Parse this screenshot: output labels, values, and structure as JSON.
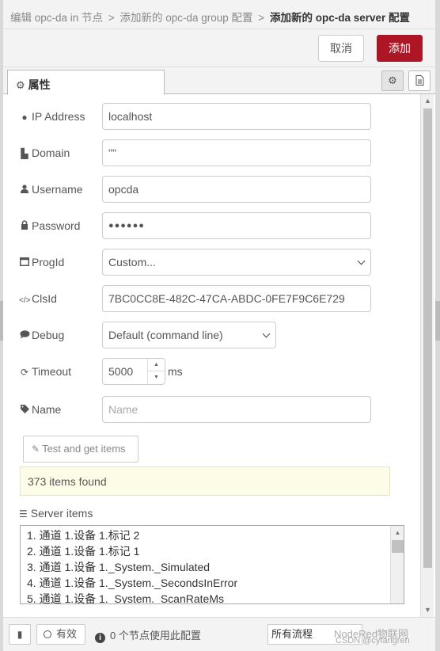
{
  "breadcrumb": {
    "items": [
      "编辑 opc-da in 节点",
      "添加新的 opc-da group 配置"
    ],
    "separator": ">",
    "current": "添加新的 opc-da server 配置"
  },
  "actions": {
    "cancel": "取消",
    "add": "添加"
  },
  "tabs": {
    "properties": "属性"
  },
  "form": {
    "ip_address": {
      "label": "IP Address",
      "value": "localhost"
    },
    "domain": {
      "label": "Domain",
      "value": "\"\""
    },
    "username": {
      "label": "Username",
      "value": "opcda"
    },
    "password": {
      "label": "Password",
      "value": "●●●●●●"
    },
    "progid": {
      "label": "ProgId",
      "value": "Custom..."
    },
    "clsid": {
      "label": "ClsId",
      "value": "7BC0CC8E-482C-47CA-ABDC-0FE7F9C6E729"
    },
    "debug": {
      "label": "Debug",
      "value": "Default (command line)"
    },
    "timeout": {
      "label": "Timeout",
      "value": "5000",
      "unit": "ms"
    },
    "name": {
      "label": "Name",
      "placeholder": "Name",
      "value": ""
    }
  },
  "test_button": "Test and get items",
  "found_message": "373 items found",
  "server_items": {
    "label": "Server items",
    "items": [
      "1. 通道 1.设备 1.标记 2",
      "2. 通道 1.设备 1.标记 1",
      "3. 通道 1.设备 1._System._Simulated",
      "4. 通道 1.设备 1._System._SecondsInError",
      "5. 通道 1.设备 1._System._ScanRateMs"
    ]
  },
  "footer": {
    "valid": "有效",
    "info": "0 个节点使用此配置",
    "scope": "所有流程",
    "watermark_line1": "NodeRed物联网",
    "watermark_line2": "CSDN @cyfangren"
  },
  "colors": {
    "primary": "#ad1625",
    "found_bg": "#fdfde7"
  }
}
